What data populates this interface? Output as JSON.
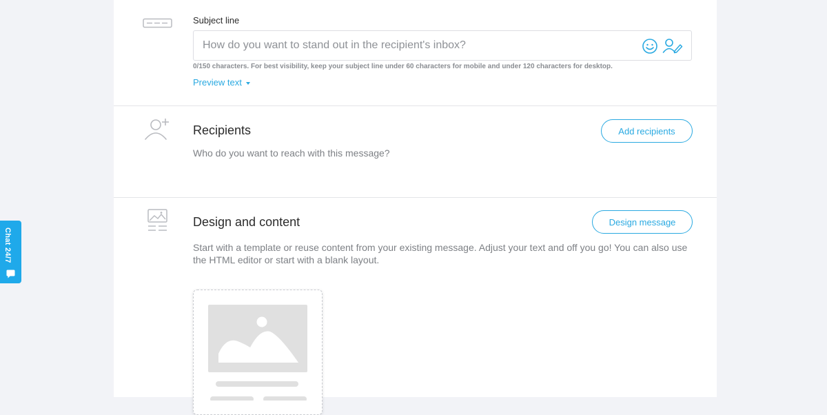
{
  "subject": {
    "label": "Subject line",
    "placeholder": "How do you want to stand out in the recipient's inbox?",
    "hint": "0/150 characters. For best visibility, keep your subject line under 60 characters for mobile and under 120 characters for desktop.",
    "preview_link": "Preview text",
    "icons": [
      "emoji-icon",
      "personalize-icon"
    ]
  },
  "recipients": {
    "title": "Recipients",
    "description": "Who do you want to reach with this message?",
    "button": "Add recipients",
    "icon": "add-user-icon"
  },
  "design": {
    "title": "Design and content",
    "description": "Start with a template or reuse content from your existing message. Adjust your text and off you go! You can also use the HTML editor or start with a blank layout.",
    "button": "Design message",
    "icon": "image-layout-icon"
  },
  "chat": {
    "label": "Chat 24/7"
  },
  "colors": {
    "accent": "#29a9e1",
    "chat_bg": "#1fa9ea",
    "page_bg": "#f2f3f7"
  }
}
